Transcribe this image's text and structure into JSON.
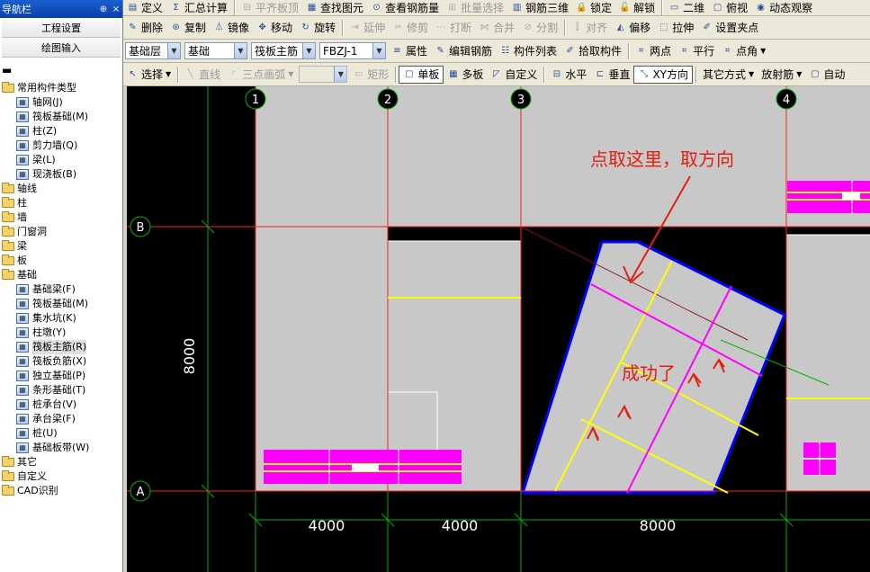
{
  "nav": {
    "title": "导航栏",
    "pin_glyph": "⊕",
    "close_glyph": "×",
    "buttons": [
      "工程设置",
      "绘图输入"
    ],
    "collapse_glyph": "▬",
    "tree": [
      {
        "label": "常用构件类型",
        "level": 0,
        "type": "folder"
      },
      {
        "label": "轴网(J)",
        "level": 1,
        "type": "item",
        "icon": "grid-icon"
      },
      {
        "label": "筏板基础(M)",
        "level": 1,
        "type": "item",
        "icon": "raft-foundation-icon"
      },
      {
        "label": "柱(Z)",
        "level": 1,
        "type": "item",
        "icon": "column-icon"
      },
      {
        "label": "剪力墙(Q)",
        "level": 1,
        "type": "item",
        "icon": "shear-wall-icon"
      },
      {
        "label": "梁(L)",
        "level": 1,
        "type": "item",
        "icon": "beam-icon"
      },
      {
        "label": "现浇板(B)",
        "level": 1,
        "type": "item",
        "icon": "slab-icon"
      },
      {
        "label": "轴线",
        "level": 0,
        "type": "folder"
      },
      {
        "label": "柱",
        "level": 0,
        "type": "folder"
      },
      {
        "label": "墙",
        "level": 0,
        "type": "folder"
      },
      {
        "label": "门窗洞",
        "level": 0,
        "type": "folder"
      },
      {
        "label": "梁",
        "level": 0,
        "type": "folder"
      },
      {
        "label": "板",
        "level": 0,
        "type": "folder"
      },
      {
        "label": "基础",
        "level": 0,
        "type": "folder"
      },
      {
        "label": "基础梁(F)",
        "level": 1,
        "type": "item",
        "icon": "foundation-beam-icon"
      },
      {
        "label": "筏板基础(M)",
        "level": 1,
        "type": "item",
        "icon": "raft-foundation-icon"
      },
      {
        "label": "集水坑(K)",
        "level": 1,
        "type": "item",
        "icon": "sump-pit-icon"
      },
      {
        "label": "柱墩(Y)",
        "level": 1,
        "type": "item",
        "icon": "column-pier-icon"
      },
      {
        "label": "筏板主筋(R)",
        "level": 1,
        "type": "item",
        "icon": "raft-main-rebar-icon",
        "selected": true
      },
      {
        "label": "筏板负筋(X)",
        "level": 1,
        "type": "item",
        "icon": "raft-negative-rebar-icon"
      },
      {
        "label": "独立基础(P)",
        "level": 1,
        "type": "item",
        "icon": "isolated-footing-icon"
      },
      {
        "label": "条形基础(T)",
        "level": 1,
        "type": "item",
        "icon": "strip-footing-icon"
      },
      {
        "label": "桩承台(V)",
        "level": 1,
        "type": "item",
        "icon": "pile-cap-icon"
      },
      {
        "label": "承台梁(F)",
        "level": 1,
        "type": "item",
        "icon": "cap-beam-icon"
      },
      {
        "label": "桩(U)",
        "level": 1,
        "type": "item",
        "icon": "pile-icon"
      },
      {
        "label": "基础板带(W)",
        "level": 1,
        "type": "item",
        "icon": "foundation-strip-icon"
      },
      {
        "label": "其它",
        "level": 0,
        "type": "folder"
      },
      {
        "label": "自定义",
        "level": 0,
        "type": "folder"
      },
      {
        "label": "CAD识别",
        "level": 0,
        "type": "folder"
      }
    ]
  },
  "toolbar1": [
    {
      "label": "定义",
      "icon": "define-icon",
      "glyph": "▤"
    },
    {
      "label": "汇总计算",
      "icon": "sum-icon",
      "glyph": "Σ"
    },
    {
      "label": "平齐板顶",
      "icon": "flush-slab-icon",
      "glyph": "⊟",
      "disabled": true
    },
    {
      "label": "查找图元",
      "icon": "find-icon",
      "glyph": "▦"
    },
    {
      "label": "查看钢筋量",
      "icon": "view-rebar-icon",
      "glyph": "⊙"
    },
    {
      "label": "批量选择",
      "icon": "batch-select-icon",
      "glyph": "⊞",
      "disabled": true
    },
    {
      "label": "钢筋三维",
      "icon": "rebar-3d-icon",
      "glyph": "▥"
    },
    {
      "label": "锁定",
      "icon": "lock-icon",
      "glyph": "🔒"
    },
    {
      "label": "解锁",
      "icon": "unlock-icon",
      "glyph": "🔓"
    },
    {
      "label": "二维",
      "icon": "2d-icon",
      "glyph": "▭"
    },
    {
      "label": "俯视",
      "icon": "top-view-icon",
      "glyph": "▢"
    },
    {
      "label": "动态观察",
      "icon": "orbit-icon",
      "glyph": "◉"
    }
  ],
  "toolbar2": [
    {
      "label": "删除",
      "icon": "delete-icon",
      "glyph": "✎"
    },
    {
      "label": "复制",
      "icon": "copy-icon",
      "glyph": "⊛"
    },
    {
      "label": "镜像",
      "icon": "mirror-icon",
      "glyph": "⏃"
    },
    {
      "label": "移动",
      "icon": "move-icon",
      "glyph": "✥"
    },
    {
      "label": "旋转",
      "icon": "rotate-icon",
      "glyph": "↻"
    },
    {
      "label": "延伸",
      "icon": "extend-icon",
      "glyph": "⇥",
      "disabled": true
    },
    {
      "label": "修剪",
      "icon": "trim-icon",
      "glyph": "✂",
      "disabled": true
    },
    {
      "label": "打断",
      "icon": "break-icon",
      "glyph": "⋯",
      "disabled": true
    },
    {
      "label": "合并",
      "icon": "merge-icon",
      "glyph": "⋈",
      "disabled": true
    },
    {
      "label": "分割",
      "icon": "split-icon",
      "glyph": "⊘",
      "disabled": true
    },
    {
      "label": "对齐",
      "icon": "align-icon",
      "glyph": "⫿",
      "disabled": true
    },
    {
      "label": "偏移",
      "icon": "offset-icon",
      "glyph": "◭"
    },
    {
      "label": "拉伸",
      "icon": "stretch-icon",
      "glyph": "⬚"
    },
    {
      "label": "设置夹点",
      "icon": "grip-icon",
      "glyph": "✐"
    }
  ],
  "toolbar3": {
    "layer_combo": "基础层",
    "category_combo": "基础",
    "type_combo": "筏板主筋",
    "name_combo": "FBZJ-1",
    "buttons": [
      {
        "label": "属性",
        "icon": "properties-icon",
        "glyph": "≡"
      },
      {
        "label": "编辑钢筋",
        "icon": "edit-rebar-icon",
        "glyph": "✎"
      },
      {
        "label": "构件列表",
        "icon": "component-list-icon",
        "glyph": "☷"
      },
      {
        "label": "拾取构件",
        "icon": "pick-component-icon",
        "glyph": "✐"
      }
    ],
    "right_buttons": [
      {
        "label": "两点",
        "icon": "two-point-icon",
        "glyph": "⌗"
      },
      {
        "label": "平行",
        "icon": "parallel-icon",
        "glyph": "⌗"
      },
      {
        "label": "点角",
        "icon": "point-angle-icon",
        "glyph": "⌗"
      }
    ]
  },
  "toolbar4": {
    "select_label": "选择",
    "line_label": "直线",
    "arc_label": "三点画弧",
    "rect_label": "矩形",
    "buttons": [
      {
        "label": "单板",
        "icon": "single-slab-icon",
        "glyph": "▢",
        "checked": true
      },
      {
        "label": "多板",
        "icon": "multi-slab-icon",
        "glyph": "▦"
      },
      {
        "label": "自定义",
        "icon": "custom-icon",
        "glyph": "◸"
      },
      {
        "label": "水平",
        "icon": "horizontal-icon",
        "glyph": "⊟"
      },
      {
        "label": "垂直",
        "icon": "vertical-icon",
        "glyph": "⊏"
      },
      {
        "label": "XY方向",
        "icon": "xy-direction-icon",
        "glyph": "⤡",
        "checked": true
      },
      {
        "label": "其它方式",
        "icon": "",
        "glyph": "",
        "dropdown": true
      },
      {
        "label": "放射筋",
        "icon": "",
        "glyph": "",
        "dropdown": true
      },
      {
        "label": "自动",
        "icon": "auto-icon",
        "glyph": "▢"
      }
    ]
  },
  "drawing": {
    "axis_labels": {
      "col1": "1",
      "col2": "2",
      "col3": "3",
      "col4": "4",
      "rowA": "A",
      "rowB": "B"
    },
    "dim_vertical": "8000",
    "dim_bottom": [
      "4000",
      "4000",
      "8000"
    ],
    "annotation_top": "点取这里，取方向",
    "annotation_success": "成功了",
    "colors": {
      "grid_red": "#ff2020",
      "grid_green": "#00b000",
      "slab_gray": "#c8c8c8",
      "rebar_yellow": "#ffff00",
      "rebar_magenta": "#ff00ff",
      "boundary_blue": "#0000ff",
      "annotation_red": "#e02010"
    }
  }
}
